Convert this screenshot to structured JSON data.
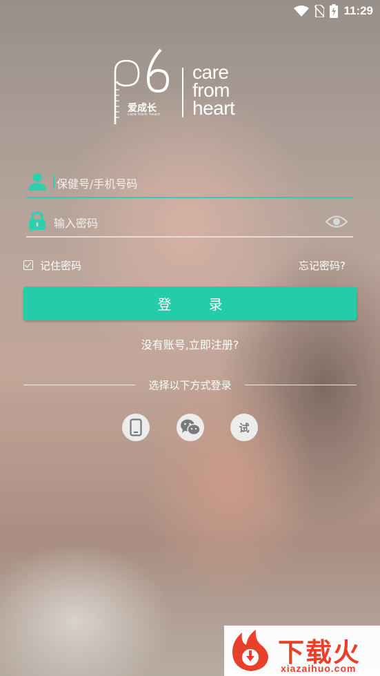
{
  "status_bar": {
    "time": "11:29"
  },
  "logo": {
    "mark": "p6",
    "chinese": "爱成长",
    "subtitle": "care from heart",
    "slogan_lines": [
      "care",
      "from",
      "heart"
    ]
  },
  "form": {
    "account_placeholder": "保健号/手机号码",
    "password_placeholder": "输入密码",
    "remember_label": "记住密码",
    "remember_checked": true,
    "forgot_label": "忘记密码?",
    "login_label": "登录",
    "register_label": "没有账号,立即注册?"
  },
  "alt_login": {
    "divider_text": "选择以下方式登录",
    "options": [
      {
        "name": "phone",
        "icon": "phone-icon"
      },
      {
        "name": "wechat",
        "icon": "wechat-icon"
      },
      {
        "name": "trial",
        "icon": "trial-icon",
        "glyph": "试"
      }
    ]
  },
  "watermark": {
    "text": "下载火",
    "url": "xiazaihuo.com"
  },
  "colors": {
    "accent": "#25ccaa",
    "watermark_red": "#e8402a"
  }
}
